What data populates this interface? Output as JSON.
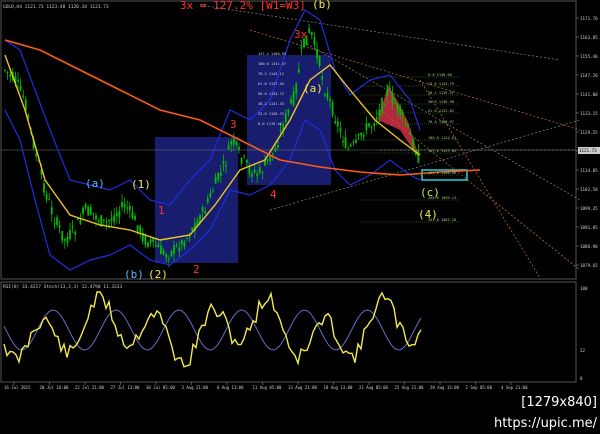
{
  "symbol_info": "GOLD,H4  1121.73 1123.48 1120.34 1121.73",
  "indicator_info": "RSI(8) 33.4217  Stoch(13,3,3) 12.4790 11.3233",
  "title_annotation": "3x = 127.2% [W1=W3]",
  "watermark": "[1279x840] https://upic.me/",
  "price_axis": {
    "labels": [
      "1171.70",
      "1163.85",
      "1155.40",
      "1147.20",
      "1141.00",
      "1133.15",
      "1129.25",
      "1117.70",
      "1114.05",
      "1102.50",
      "1099.35",
      "1091.05",
      "1086.90",
      "1079.65"
    ],
    "current": "1121.73"
  },
  "rsi_axis": {
    "labels": [
      "100",
      "32",
      "0"
    ]
  },
  "time_axis": [
    "16 Jul 2015",
    "20 Jul 16:00",
    "22 Jul 21:00",
    "27 Jul 13:00",
    "30 Jul 05:00",
    "3 Aug 21:00",
    "6 Aug 13:00",
    "11 Aug 05:00",
    "13 Aug 21:00",
    "18 Aug 13:00",
    "21 Aug 05:00",
    "25 Aug 21:00",
    "28 Aug 13:00",
    "2 Sep 05:00",
    "4 Sep 21:00"
  ],
  "wave_labels": [
    {
      "text": "(a)",
      "color": "#5ab4ff"
    },
    {
      "text": "(1)",
      "color": "#f2e94e"
    },
    {
      "text": "(b)",
      "color": "#5ab4ff"
    },
    {
      "text": "(2)",
      "color": "#f2e94e"
    },
    {
      "text": "1",
      "color": "#ff3030"
    },
    {
      "text": "2",
      "color": "#ff3030"
    },
    {
      "text": "3",
      "color": "#ff3030"
    },
    {
      "text": "4",
      "color": "#ff3030"
    },
    {
      "text": "(a)",
      "color": "#f2e94e"
    },
    {
      "text": "(b)",
      "color": "#f2e94e"
    },
    {
      "text": "3x",
      "color": "#ff3030"
    },
    {
      "text": "(c)",
      "color": "#c8e85a"
    },
    {
      "text": "(4)",
      "color": "#f2e94e"
    }
  ],
  "fib_labels": {
    "left_box": [
      "127.2 1160.95",
      "100.0 1151.47",
      "76.4 1143.12",
      "61.8 1137.44",
      "50.0 1134.72",
      "38.2 1131.33",
      "23.6 1126.72",
      "0.0 1119.40"
    ],
    "right_zone": [
      "0.0 1148.60",
      "23.6 1143.79",
      "38.2 1139.97",
      "50.0 1136.90",
      "61.8 1133.82",
      "76.4 1129.97",
      "100.0 1124.01",
      "127.2 1117.83",
      "161.8 1108.96",
      "200.0 1099.13",
      "261.8 1083.18"
    ]
  },
  "colors": {
    "candle": "#00c000",
    "ma_yellow": "#f0c420",
    "ma_red": "#ff5a1a",
    "envelope": "#1f2de0",
    "box": "#1c2280",
    "rsi": "#f2e94e",
    "rsi_sig": "#6a6ac8",
    "target_box": "#2bd0e0"
  }
}
